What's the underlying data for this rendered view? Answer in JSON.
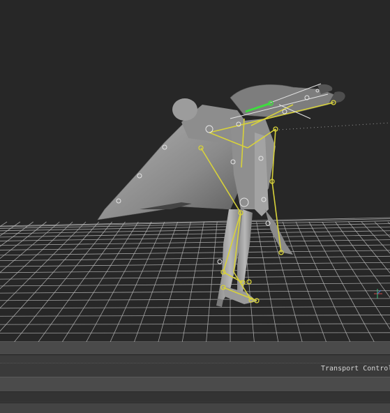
{
  "transport": {
    "label": "Transport Controls"
  },
  "icons": {
    "axis": "axis-gizmo-icon"
  },
  "colors": {
    "viewport_bg": "#272727",
    "grid": "#bdbdbd",
    "bone": "#d8d23a",
    "selected_bone": "#3fdc3f",
    "model": "#9a9a9a",
    "panel": "#3a3a3a"
  }
}
